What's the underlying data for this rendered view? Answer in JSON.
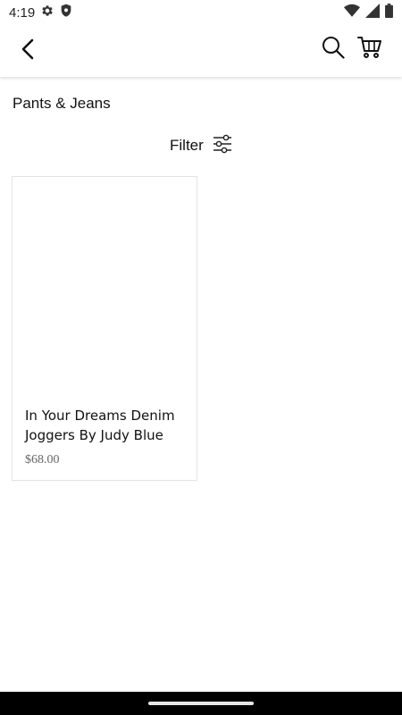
{
  "status_bar": {
    "time": "4:19",
    "left_icons": [
      "gear-icon",
      "shield-icon"
    ],
    "right_icons": [
      "wifi-icon",
      "signal-icon",
      "battery-icon"
    ]
  },
  "app_bar": {
    "icons": [
      "back-arrow-icon",
      "search-icon",
      "cart-icon"
    ]
  },
  "page": {
    "title": "Pants & Jeans",
    "filter_label": "Filter"
  },
  "products": [
    {
      "name": "In Your Dreams Denim Joggers By Judy Blue",
      "price": "$68.00"
    }
  ],
  "colors": {
    "background": "#ffffff",
    "text": "#111111",
    "price_text": "#666666",
    "card_border": "#e3e3e3",
    "nav_bar": "#000000"
  }
}
